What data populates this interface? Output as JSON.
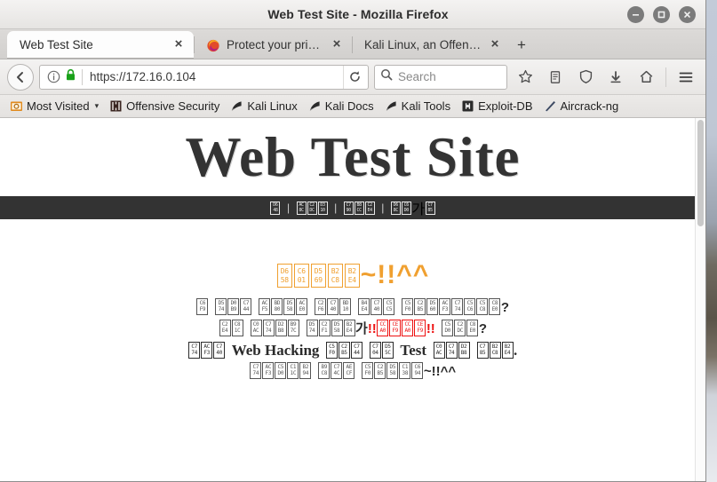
{
  "window": {
    "title": "Web Test Site - Mozilla Firefox",
    "controls": {
      "minimize": "−",
      "maximize": "□",
      "close": "×"
    }
  },
  "tabs": [
    {
      "label": "Web Test Site",
      "close": "×",
      "active": true,
      "favicon": "none"
    },
    {
      "label": "Protect your privacy a...",
      "close": "×",
      "active": false,
      "favicon": "firefox-icon"
    },
    {
      "label": "Kali Linux, an Offensive S...",
      "close": "×",
      "active": false,
      "favicon": "none"
    }
  ],
  "new_tab_label": "+",
  "toolbar": {
    "back_icon": "back-arrow-icon",
    "identity_icon": "info-icon",
    "lock_icon": "padlock-icon",
    "url": "https://172.16.0.104",
    "reload_icon": "reload-icon",
    "search_placeholder": "Search",
    "search_icon": "magnifier-icon",
    "icons": [
      "bookmark-star-icon",
      "reader-list-icon",
      "shield-icon",
      "downloads-icon",
      "home-icon",
      "hamburger-menu-icon"
    ]
  },
  "bookmarks": [
    {
      "label": "Most Visited",
      "icon": "most-visited-icon",
      "caret": "▾"
    },
    {
      "label": "Offensive Security",
      "icon": "offensive-security-icon"
    },
    {
      "label": "Kali Linux",
      "icon": "kali-dragon-icon"
    },
    {
      "label": "Kali Docs",
      "icon": "kali-dragon-icon"
    },
    {
      "label": "Kali Tools",
      "icon": "kali-dragon-icon"
    },
    {
      "label": "Exploit-DB",
      "icon": "exploit-db-icon"
    },
    {
      "label": "Aircrack-ng",
      "icon": "aircrack-ng-icon"
    }
  ],
  "page": {
    "heading": "Web Test Site",
    "nav_separator": "|",
    "nav_items": [
      {
        "name": "home",
        "text": "홈",
        "codepoints": [
          "D648"
        ]
      },
      {
        "name": "board",
        "text": "게시판",
        "codepoints": [
          "AC8C",
          "C2DC",
          "D310"
        ]
      },
      {
        "name": "data-room",
        "text": "자료실",
        "codepoints": [
          "C790",
          "B8CC",
          "C2E4"
        ]
      },
      {
        "name": "join",
        "text": "회원가입",
        "codepoints": [
          "D68C",
          "C6D0",
          "AC00",
          "C785"
        ]
      }
    ],
    "welcome": {
      "text": "환영합니다~!!^^",
      "codepoints": [
        "D658",
        "C601",
        "D569",
        "B2C8",
        "B2E4"
      ],
      "suffix": "~!!^^",
      "color": "#f0a030"
    },
    "lines": [
      {
        "name": "line-1",
        "codepoints": [
          "C6F9",
          "",
          "D574",
          "D0B9",
          "C744",
          "",
          "ACF5",
          "BD80",
          "D558",
          "ACE0",
          "",
          "C2F6",
          "C740",
          "BD10",
          "",
          "B4E4",
          "C740",
          "C5C5",
          "",
          "C5F0",
          "C2B5",
          "D560",
          "ACF3",
          "C774",
          "C5C6",
          "C5C8",
          "C8E0"
        ],
        "suffix": "?"
      },
      {
        "name": "line-2",
        "codepoints": [
          "C2E4",
          "C81C",
          "",
          "C0AC",
          "C774",
          "D2B8",
          "B97C",
          "",
          "D574",
          "C2F1",
          "D558",
          "B2E4",
          "AC00"
        ],
        "emphasis": {
          "codepoints": [
            "CCA0",
            "CEF9",
            "CCA0",
            "CEF9"
          ],
          "prefix": "!!",
          "suffix": "!!",
          "color": "#ee1111"
        },
        "tail_codepoints": [
          "C5D0",
          "C2DC",
          "C8E0"
        ],
        "suffix": "?"
      },
      {
        "name": "line-3",
        "big": true,
        "parts": [
          {
            "type": "tofu",
            "codepoints": [
              "C774",
              "ACF3",
              "C740"
            ]
          },
          {
            "type": "text",
            "value": "Web Hacking"
          },
          {
            "type": "tofu",
            "codepoints": [
              "C5F0",
              "C2B5",
              "C744"
            ]
          },
          {
            "type": "tofu",
            "codepoints": [
              "C704",
              "D55C"
            ]
          },
          {
            "type": "text",
            "value": "Test"
          },
          {
            "type": "tofu",
            "codepoints": [
              "C0AC",
              "C774",
              "D2B8"
            ]
          },
          {
            "type": "tofu",
            "codepoints": [
              "C785",
              "B2C8",
              "B2E4"
            ]
          },
          {
            "type": "text",
            "value": "."
          }
        ]
      },
      {
        "name": "line-4",
        "codepoints": [
          "C774",
          "ACF3",
          "C5D0",
          "C11C",
          "B294",
          "",
          "B9C8",
          "C74C",
          "AECF",
          "",
          "C5F0",
          "C2B5",
          "D558",
          "C138",
          "C694"
        ],
        "suffix": "~!!^^"
      }
    ]
  }
}
